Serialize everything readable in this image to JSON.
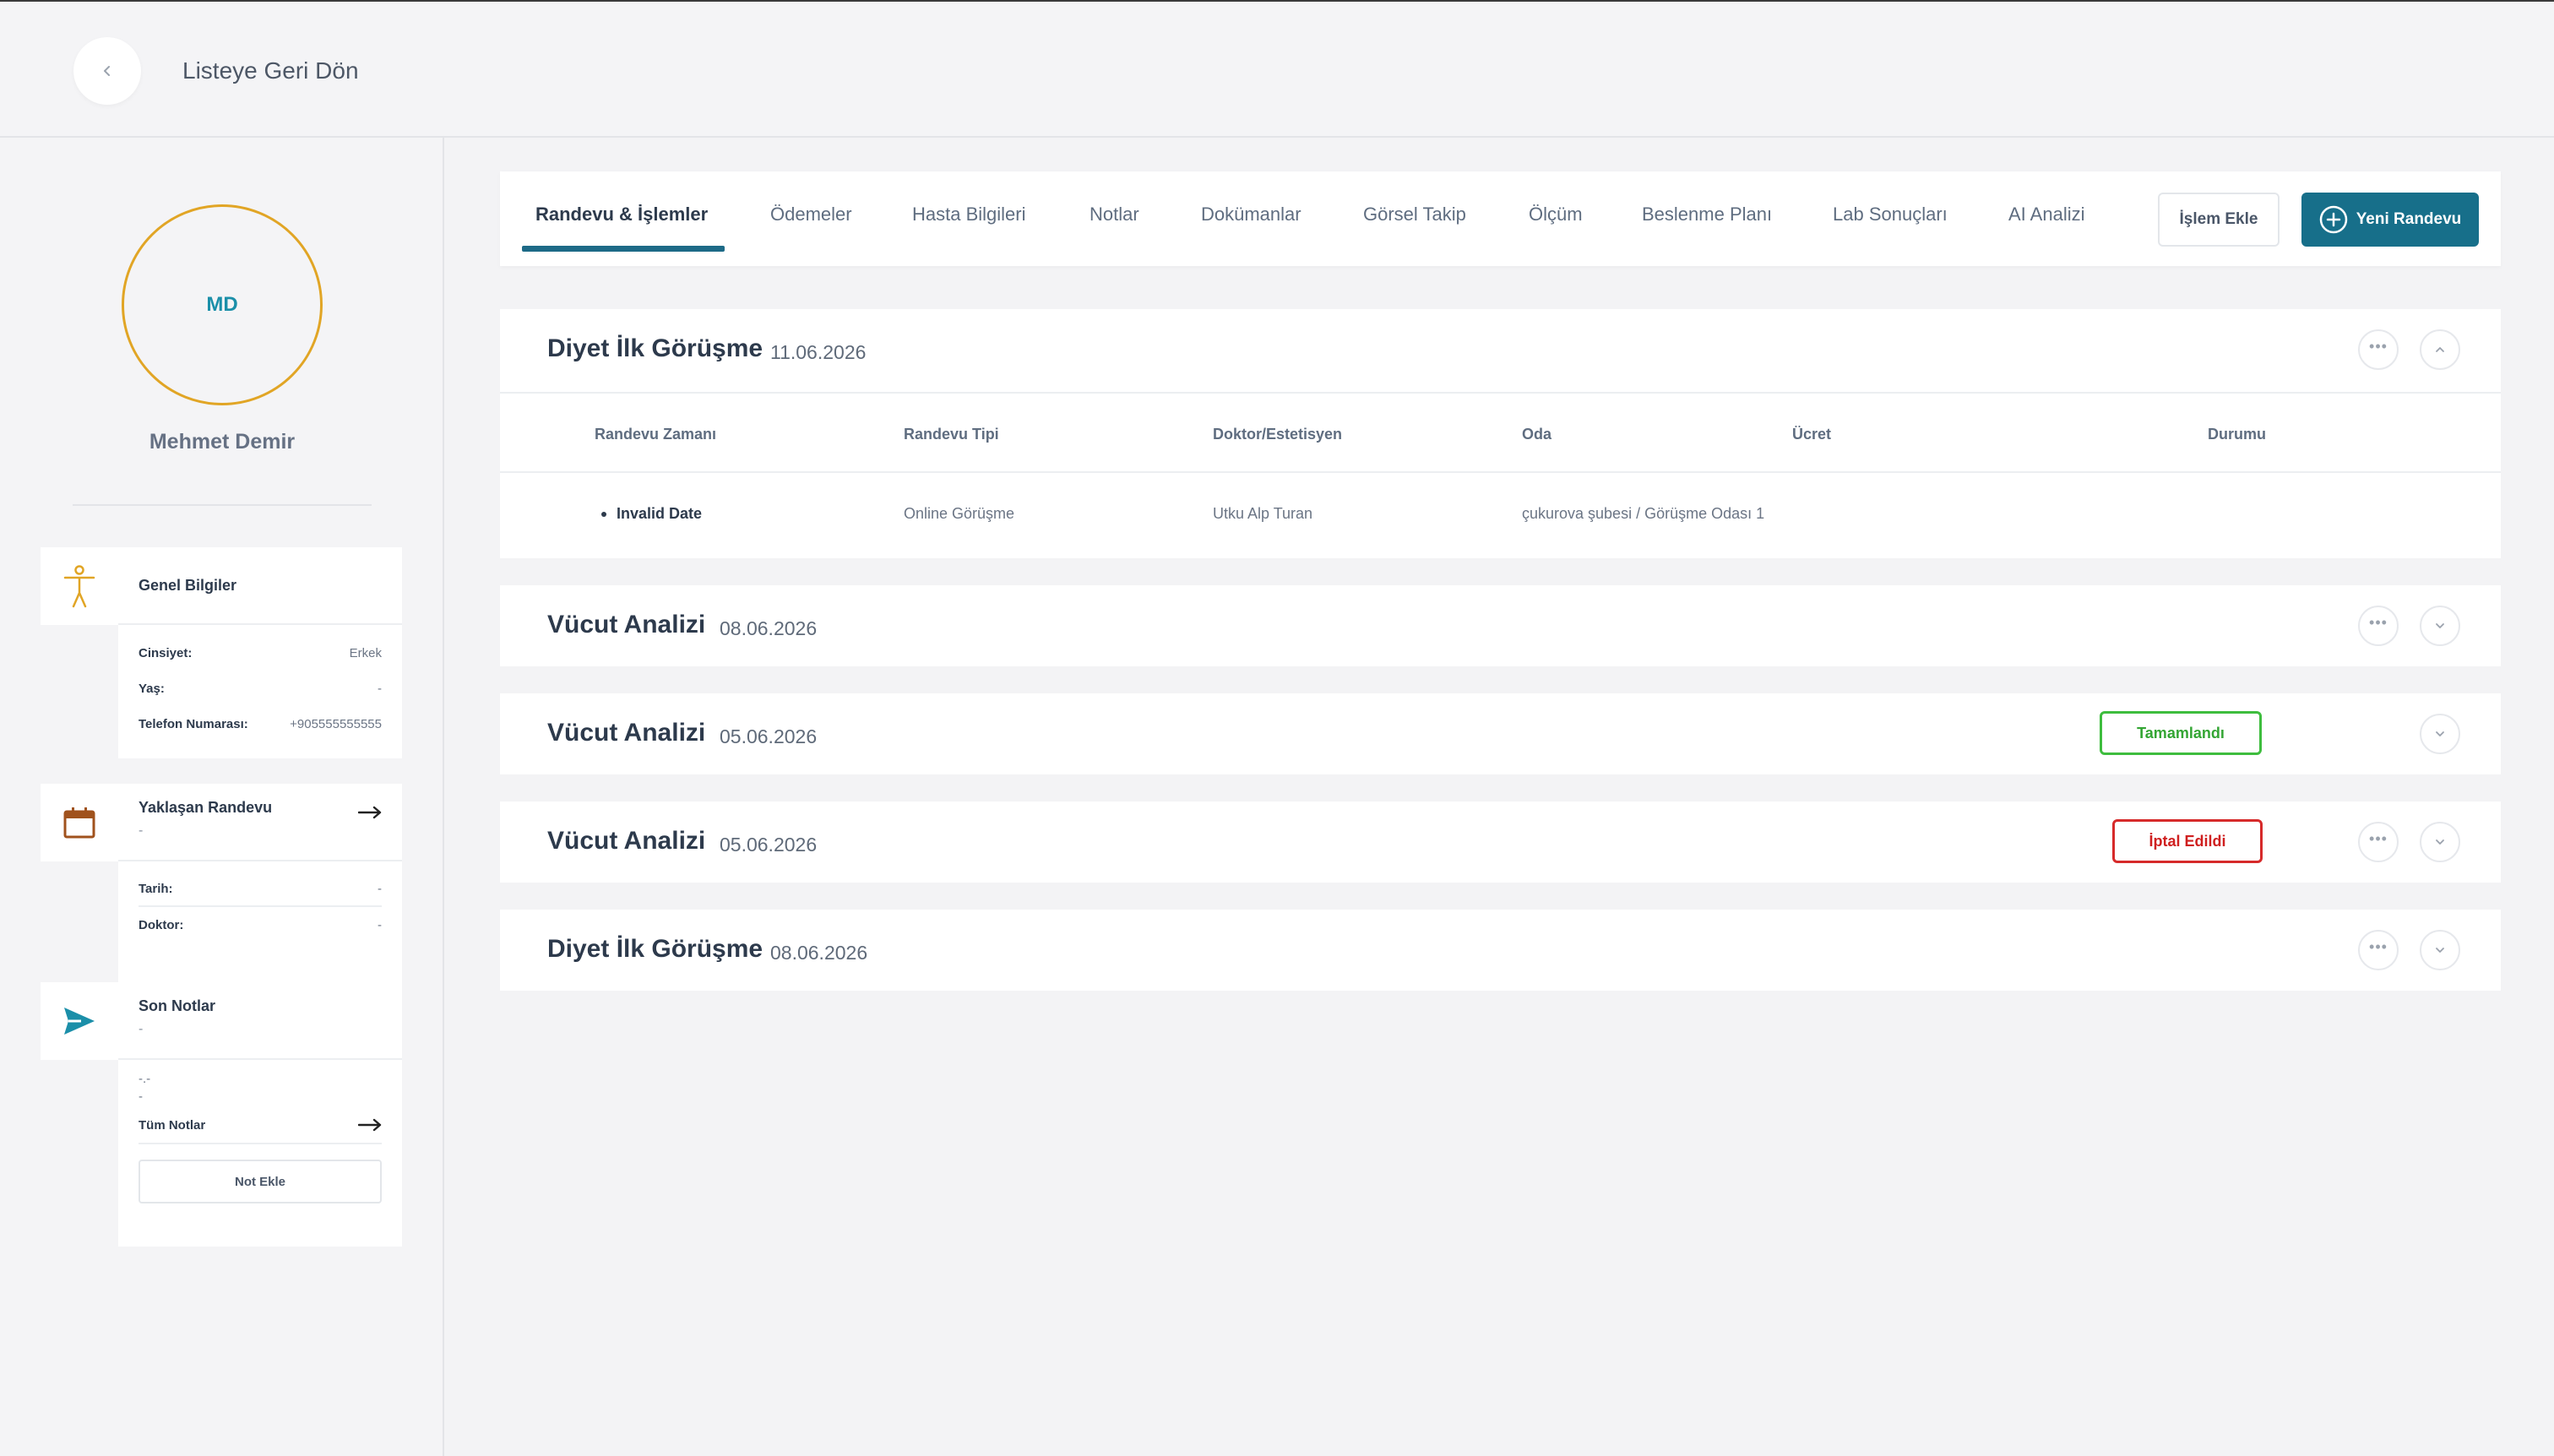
{
  "header": {
    "back_label": "Listeye Geri Dön"
  },
  "patient": {
    "initials": "MD",
    "name": "Mehmet Demir"
  },
  "general_info": {
    "title": "Genel Bilgiler",
    "rows": [
      {
        "label": "Cinsiyet:",
        "value": "Erkek"
      },
      {
        "label": "Yaş:",
        "value": "-"
      },
      {
        "label": "Telefon Numarası:",
        "value": "+905555555555"
      }
    ]
  },
  "upcoming": {
    "title": "Yaklaşan Randevu",
    "subtitle": "-",
    "rows": [
      {
        "label": "Tarih:",
        "value": "-"
      },
      {
        "label": "Doktor:",
        "value": "-"
      }
    ]
  },
  "notes": {
    "title": "Son Notlar",
    "subtitle": "-",
    "line1": "-.-",
    "line2": "-",
    "all_notes_label": "Tüm Notlar",
    "add_note_label": "Not Ekle"
  },
  "tabs": [
    {
      "label": "Randevu & İşlemler",
      "active": true
    },
    {
      "label": "Ödemeler"
    },
    {
      "label": "Hasta Bilgileri"
    },
    {
      "label": "Notlar"
    },
    {
      "label": "Dokümanlar"
    },
    {
      "label": "Görsel Takip"
    },
    {
      "label": "Ölçüm"
    },
    {
      "label": "Beslenme Planı"
    },
    {
      "label": "Lab Sonuçları"
    },
    {
      "label": "AI Analizi"
    }
  ],
  "actions": {
    "add_process": "İşlem Ekle",
    "new_appointment": "Yeni Randevu"
  },
  "table_headers": [
    "Randevu Zamanı",
    "Randevu Tipi",
    "Doktor/Estetisyen",
    "Oda",
    "Ücret",
    "Durumu"
  ],
  "appointments": [
    {
      "title": "Diyet İlk Görüşme",
      "date": "11.06.2026",
      "expanded": true,
      "row": {
        "time": "Invalid Date",
        "type": "Online Görüşme",
        "doctor": "Utku Alp Turan",
        "room": "çukurova şubesi / Görüşme Odası 1",
        "fee": "",
        "status": ""
      }
    },
    {
      "title": "Vücut Analizi",
      "date": "08.06.2026"
    },
    {
      "title": "Vücut Analizi",
      "date": "05.06.2026",
      "status": "Tamamlandı"
    },
    {
      "title": "Vücut Analizi",
      "date": "05.06.2026",
      "status": "İptal Edildi"
    },
    {
      "title": "Diyet İlk Görüşme",
      "date": "08.06.2026"
    }
  ],
  "colors": {
    "primary": "#176f8a",
    "avatar_ring": "#e1a525",
    "success": "#3ebd3e",
    "danger": "#d62a2a"
  }
}
